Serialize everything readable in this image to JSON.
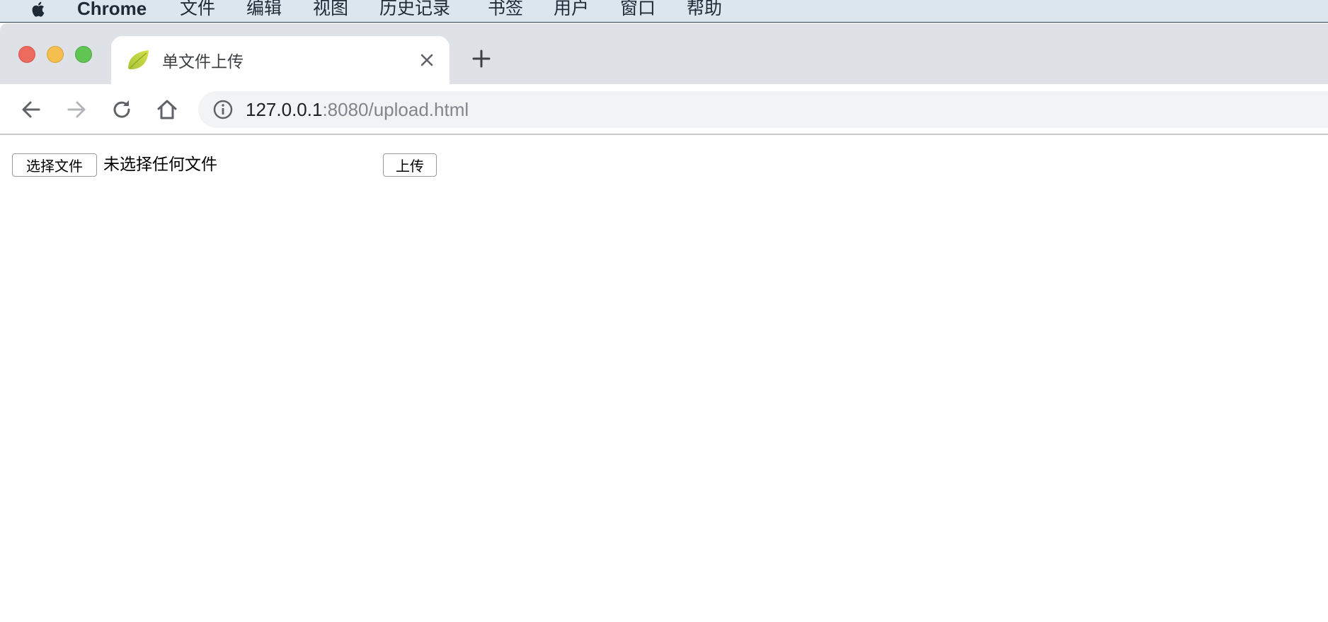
{
  "menubar": {
    "app_name": "Chrome",
    "items": [
      "文件",
      "编辑",
      "视图",
      "历史记录",
      "书签",
      "用户",
      "窗口",
      "帮助"
    ]
  },
  "tab": {
    "title": "单文件上传",
    "favicon": "spring-leaf-icon"
  },
  "address_bar": {
    "host": "127.0.0.1",
    "rest": ":8080/upload.html"
  },
  "form": {
    "choose_file_label": "选择文件",
    "file_status": "未选择任何文件",
    "upload_label": "上传"
  },
  "colors": {
    "menubar_bg": "#dce6ee",
    "tabstrip_bg": "#dee1e6",
    "omnibox_bg": "#f1f3f4",
    "traffic_close": "#ed6a5e",
    "traffic_minimize": "#f5bf4f",
    "traffic_maximize": "#61c554"
  }
}
